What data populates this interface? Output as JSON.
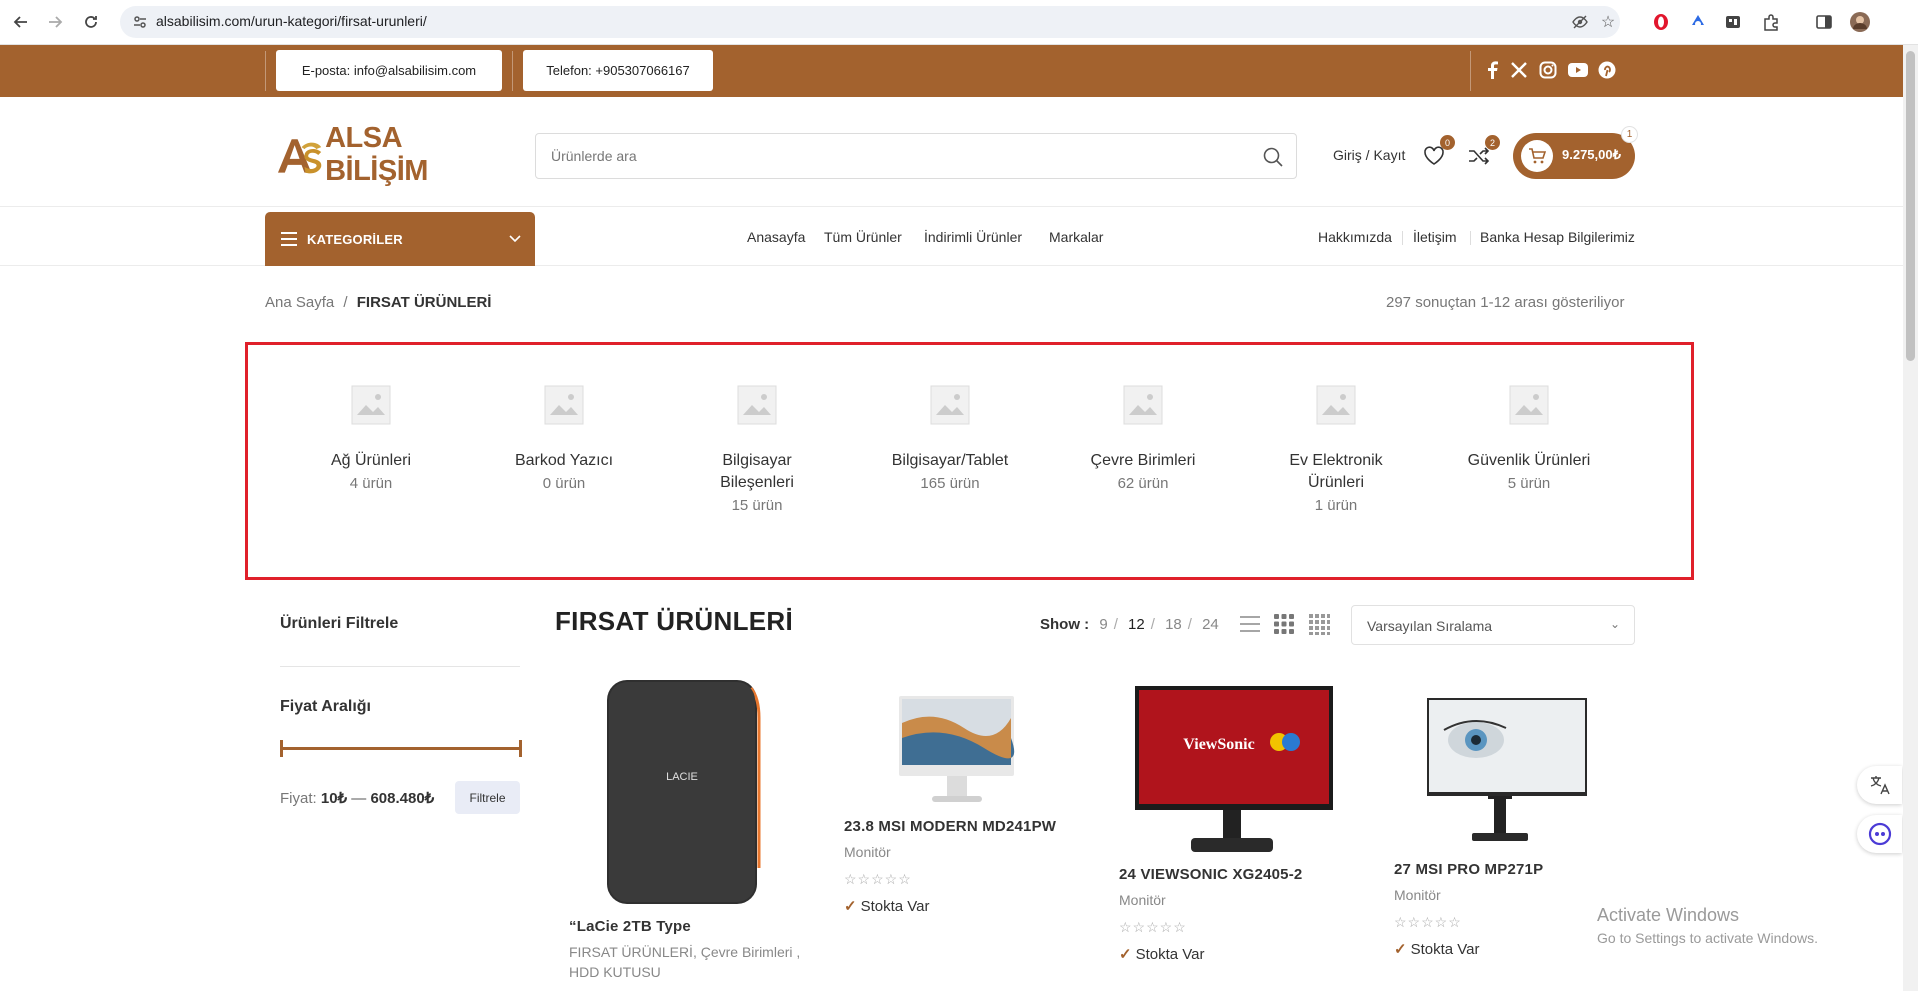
{
  "browser": {
    "url": "alsabilisim.com/urun-kategori/firsat-urunleri/",
    "icons": [
      "back-icon",
      "forward-icon",
      "reload-icon",
      "site-info-icon",
      "eye-off-icon",
      "star-icon",
      "opera-icon",
      "extension-icon",
      "extension-icon",
      "puzzle-icon",
      "sidebar-icon",
      "profile-avatar"
    ]
  },
  "topbar": {
    "email": "E-posta: info@alsabilisim.com",
    "phone": "Telefon: +905307066167",
    "socials": [
      "facebook-icon",
      "x-icon",
      "instagram-icon",
      "youtube-icon",
      "pinterest-icon"
    ]
  },
  "header": {
    "logo_text": "ALSA BİLİŞİM",
    "search_placeholder": "Ürünlerde ara",
    "login": "Giriş / Kayıt",
    "wishlist_count": "0",
    "compare_count": "2",
    "cart_total": "9.275,00₺",
    "cart_count": "1"
  },
  "nav": {
    "categories_label": "KATEGORİLER",
    "center": [
      "Anasayfa",
      "Tüm Ürünler",
      "İndirimli Ürünler",
      "Markalar"
    ],
    "right": [
      "Hakkımızda",
      "İletişim",
      "Banka Hesap Bilgilerimiz"
    ]
  },
  "breadcrumb": {
    "home": "Ana Sayfa",
    "sep": "/",
    "current": "FIRSAT ÜRÜNLERİ"
  },
  "result_count": "297 sonuçtan 1-12 arası gösteriliyor",
  "categories": [
    {
      "name": "Ağ Ürünleri",
      "count": "4 ürün"
    },
    {
      "name": "Barkod Yazıcı",
      "count": "0 ürün"
    },
    {
      "name": "Bilgisayar Bileşenleri",
      "count": "15 ürün"
    },
    {
      "name": "Bilgisayar/Tablet",
      "count": "165 ürün"
    },
    {
      "name": "Çevre Birimleri",
      "count": "62 ürün"
    },
    {
      "name": "Ev Elektronik Ürünleri",
      "count": "1 ürün"
    },
    {
      "name": "Güvenlik Ürünleri",
      "count": "5 ürün"
    }
  ],
  "sidebar": {
    "title": "Ürünleri Filtrele",
    "price_heading": "Fiyat Aralığı",
    "price_prefix": "Fiyat:",
    "price_min": "10₺",
    "price_dash": "—",
    "price_max": "608.480₺",
    "filter_button": "Filtrele"
  },
  "listing": {
    "title": "FIRSAT ÜRÜNLERİ",
    "show_label": "Show :",
    "show_options": [
      "9",
      "12",
      "18",
      "24"
    ],
    "show_active": "12",
    "sort_value": "Varsayılan Sıralama"
  },
  "products": [
    {
      "name": "“LaCie 2TB Type",
      "category": "FIRSAT ÜRÜNLERİ, Çevre Birimleri , HDD KUTUSU",
      "stock": ""
    },
    {
      "name": "23.8 MSI MODERN MD241PW",
      "category": "Monitör",
      "stock": "Stokta Var"
    },
    {
      "name": "24 VIEWSONIC XG2405-2",
      "category": "Monitör",
      "stock": "Stokta Var"
    },
    {
      "name": "27 MSI PRO MP271P",
      "category": "Monitör",
      "stock": "Stokta Var"
    }
  ],
  "product_image_text": {
    "lacie": "LACIE",
    "viewsonic": "ViewSonic"
  },
  "watermark": {
    "line1": "Activate Windows",
    "line2": "Go to Settings to activate Windows."
  },
  "colors": {
    "brand": "#a3622e",
    "highlight_box": "#e0202a"
  }
}
